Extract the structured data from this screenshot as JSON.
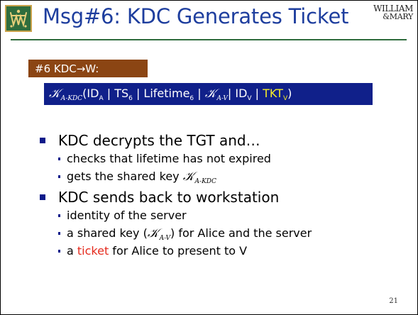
{
  "slide": {
    "title": "Msg#6: KDC Generates Ticket",
    "brand_line1": "WILLIAM",
    "brand_line2": "&MARY",
    "page_number": "21"
  },
  "message_label": "#6  KDC→W:",
  "formula": {
    "key_outer": "𝒦",
    "key_outer_sub": "A-KDC",
    "part_open": "(ID",
    "id_a_sub": "A",
    "sep1": " | TS",
    "ts_sub": "6",
    "sep2": " | Lifetime",
    "lifetime_sub": "6",
    "sep3": " | ",
    "key_av": "𝒦",
    "key_av_sub": "A-V",
    "sep4": "| ID",
    "id_v_sub": "V",
    "sep5": " | ",
    "tkt": "TKT",
    "tkt_sub": "V",
    "close": ")"
  },
  "bullets": [
    {
      "text": "KDC decrypts the TGT and…",
      "sub": [
        {
          "text": "checks that lifetime has not expired"
        },
        {
          "text_before": "gets the shared key ",
          "key": "𝒦",
          "key_sub": "A-KDC"
        }
      ]
    },
    {
      "text": "KDC sends back to workstation",
      "sub": [
        {
          "text": "identity of the server"
        },
        {
          "text_before": "a shared key (",
          "key": "𝒦",
          "key_sub": "A-V",
          "text_after": ") for Alice and the server"
        },
        {
          "text_before": "a ",
          "highlight": "ticket",
          "text_after": " for Alice to present to V"
        }
      ]
    }
  ],
  "colors": {
    "title": "#1e3e9e",
    "message_label_bg": "#8b4513",
    "formula_bg": "#10208a",
    "ticket_highlight": "#f4ec2a",
    "red_text": "#e52a1d",
    "bullet": "#0d1a8a",
    "rule": "#2e6b3c"
  }
}
